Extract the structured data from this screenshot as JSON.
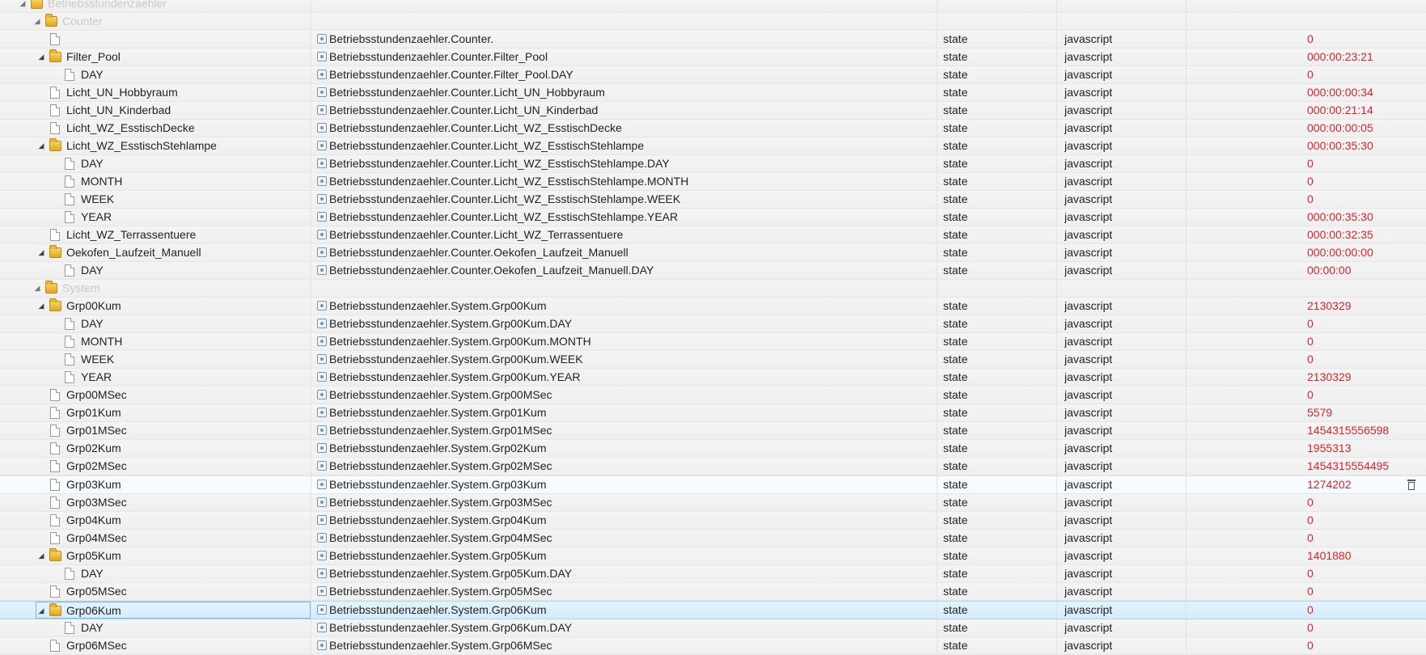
{
  "tree": {
    "rows": [
      {
        "name": "Betriebsstundenzaehler",
        "kind": "folder",
        "level": 0,
        "expanded": true,
        "group": true
      },
      {
        "name": "Counter",
        "kind": "folder",
        "level": 1,
        "expanded": true,
        "group": true
      },
      {
        "name": "",
        "kind": "file",
        "level": 2,
        "id": "Betriebsstundenzaehler.Counter.",
        "type": "state",
        "role": "javascript",
        "value": "0"
      },
      {
        "name": "Filter_Pool",
        "kind": "folder",
        "level": 2,
        "expanded": true,
        "id": "Betriebsstundenzaehler.Counter.Filter_Pool",
        "type": "state",
        "role": "javascript",
        "value": "000:00:23:21"
      },
      {
        "name": "DAY",
        "kind": "file",
        "level": 3,
        "id": "Betriebsstundenzaehler.Counter.Filter_Pool.DAY",
        "type": "state",
        "role": "javascript",
        "value": "0"
      },
      {
        "name": "Licht_UN_Hobbyraum",
        "kind": "file",
        "level": 2,
        "id": "Betriebsstundenzaehler.Counter.Licht_UN_Hobbyraum",
        "type": "state",
        "role": "javascript",
        "value": "000:00:00:34"
      },
      {
        "name": "Licht_UN_Kinderbad",
        "kind": "file",
        "level": 2,
        "id": "Betriebsstundenzaehler.Counter.Licht_UN_Kinderbad",
        "type": "state",
        "role": "javascript",
        "value": "000:00:21:14"
      },
      {
        "name": "Licht_WZ_EsstischDecke",
        "kind": "file",
        "level": 2,
        "id": "Betriebsstundenzaehler.Counter.Licht_WZ_EsstischDecke",
        "type": "state",
        "role": "javascript",
        "value": "000:00:00:05"
      },
      {
        "name": "Licht_WZ_EsstischStehlampe",
        "kind": "folder",
        "level": 2,
        "expanded": true,
        "id": "Betriebsstundenzaehler.Counter.Licht_WZ_EsstischStehlampe",
        "type": "state",
        "role": "javascript",
        "value": "000:00:35:30"
      },
      {
        "name": "DAY",
        "kind": "file",
        "level": 3,
        "id": "Betriebsstundenzaehler.Counter.Licht_WZ_EsstischStehlampe.DAY",
        "type": "state",
        "role": "javascript",
        "value": "0"
      },
      {
        "name": "MONTH",
        "kind": "file",
        "level": 3,
        "id": "Betriebsstundenzaehler.Counter.Licht_WZ_EsstischStehlampe.MONTH",
        "type": "state",
        "role": "javascript",
        "value": "0"
      },
      {
        "name": "WEEK",
        "kind": "file",
        "level": 3,
        "id": "Betriebsstundenzaehler.Counter.Licht_WZ_EsstischStehlampe.WEEK",
        "type": "state",
        "role": "javascript",
        "value": "0"
      },
      {
        "name": "YEAR",
        "kind": "file",
        "level": 3,
        "id": "Betriebsstundenzaehler.Counter.Licht_WZ_EsstischStehlampe.YEAR",
        "type": "state",
        "role": "javascript",
        "value": "000:00:35:30"
      },
      {
        "name": "Licht_WZ_Terrassentuere",
        "kind": "file",
        "level": 2,
        "id": "Betriebsstundenzaehler.Counter.Licht_WZ_Terrassentuere",
        "type": "state",
        "role": "javascript",
        "value": "000:00:32:35"
      },
      {
        "name": "Oekofen_Laufzeit_Manuell",
        "kind": "folder",
        "level": 2,
        "expanded": true,
        "id": "Betriebsstundenzaehler.Counter.Oekofen_Laufzeit_Manuell",
        "type": "state",
        "role": "javascript",
        "value": "000:00:00:00"
      },
      {
        "name": "DAY",
        "kind": "file",
        "level": 3,
        "id": "Betriebsstundenzaehler.Counter.Oekofen_Laufzeit_Manuell.DAY",
        "type": "state",
        "role": "javascript",
        "value": "00:00:00"
      },
      {
        "name": "System",
        "kind": "folder",
        "level": 1,
        "expanded": true,
        "group": true
      },
      {
        "name": "Grp00Kum",
        "kind": "folder",
        "level": 2,
        "expanded": true,
        "id": "Betriebsstundenzaehler.System.Grp00Kum",
        "type": "state",
        "role": "javascript",
        "value": "2130329"
      },
      {
        "name": "DAY",
        "kind": "file",
        "level": 3,
        "id": "Betriebsstundenzaehler.System.Grp00Kum.DAY",
        "type": "state",
        "role": "javascript",
        "value": "0"
      },
      {
        "name": "MONTH",
        "kind": "file",
        "level": 3,
        "id": "Betriebsstundenzaehler.System.Grp00Kum.MONTH",
        "type": "state",
        "role": "javascript",
        "value": "0"
      },
      {
        "name": "WEEK",
        "kind": "file",
        "level": 3,
        "id": "Betriebsstundenzaehler.System.Grp00Kum.WEEK",
        "type": "state",
        "role": "javascript",
        "value": "0"
      },
      {
        "name": "YEAR",
        "kind": "file",
        "level": 3,
        "id": "Betriebsstundenzaehler.System.Grp00Kum.YEAR",
        "type": "state",
        "role": "javascript",
        "value": "2130329"
      },
      {
        "name": "Grp00MSec",
        "kind": "file",
        "level": 2,
        "id": "Betriebsstundenzaehler.System.Grp00MSec",
        "type": "state",
        "role": "javascript",
        "value": "0"
      },
      {
        "name": "Grp01Kum",
        "kind": "file",
        "level": 2,
        "id": "Betriebsstundenzaehler.System.Grp01Kum",
        "type": "state",
        "role": "javascript",
        "value": "5579"
      },
      {
        "name": "Grp01MSec",
        "kind": "file",
        "level": 2,
        "id": "Betriebsstundenzaehler.System.Grp01MSec",
        "type": "state",
        "role": "javascript",
        "value": "1454315556598"
      },
      {
        "name": "Grp02Kum",
        "kind": "file",
        "level": 2,
        "id": "Betriebsstundenzaehler.System.Grp02Kum",
        "type": "state",
        "role": "javascript",
        "value": "1955313"
      },
      {
        "name": "Grp02MSec",
        "kind": "file",
        "level": 2,
        "id": "Betriebsstundenzaehler.System.Grp02MSec",
        "type": "state",
        "role": "javascript",
        "value": "1454315554495"
      },
      {
        "name": "Grp03Kum",
        "kind": "file",
        "level": 2,
        "id": "Betriebsstundenzaehler.System.Grp03Kum",
        "type": "state",
        "role": "javascript",
        "value": "1274202",
        "hover": true
      },
      {
        "name": "Grp03MSec",
        "kind": "file",
        "level": 2,
        "id": "Betriebsstundenzaehler.System.Grp03MSec",
        "type": "state",
        "role": "javascript",
        "value": "0"
      },
      {
        "name": "Grp04Kum",
        "kind": "file",
        "level": 2,
        "id": "Betriebsstundenzaehler.System.Grp04Kum",
        "type": "state",
        "role": "javascript",
        "value": "0"
      },
      {
        "name": "Grp04MSec",
        "kind": "file",
        "level": 2,
        "id": "Betriebsstundenzaehler.System.Grp04MSec",
        "type": "state",
        "role": "javascript",
        "value": "0"
      },
      {
        "name": "Grp05Kum",
        "kind": "folder",
        "level": 2,
        "expanded": true,
        "id": "Betriebsstundenzaehler.System.Grp05Kum",
        "type": "state",
        "role": "javascript",
        "value": "1401880"
      },
      {
        "name": "DAY",
        "kind": "file",
        "level": 3,
        "id": "Betriebsstundenzaehler.System.Grp05Kum.DAY",
        "type": "state",
        "role": "javascript",
        "value": "0"
      },
      {
        "name": "Grp05MSec",
        "kind": "file",
        "level": 2,
        "id": "Betriebsstundenzaehler.System.Grp05MSec",
        "type": "state",
        "role": "javascript",
        "value": "0"
      },
      {
        "name": "Grp06Kum",
        "kind": "folder",
        "level": 2,
        "expanded": true,
        "id": "Betriebsstundenzaehler.System.Grp06Kum",
        "type": "state",
        "role": "javascript",
        "value": "0",
        "selected": true
      },
      {
        "name": "DAY",
        "kind": "file",
        "level": 3,
        "id": "Betriebsstundenzaehler.System.Grp06Kum.DAY",
        "type": "state",
        "role": "javascript",
        "value": "0"
      },
      {
        "name": "Grp06MSec",
        "kind": "file",
        "level": 2,
        "id": "Betriebsstundenzaehler.System.Grp06MSec",
        "type": "state",
        "role": "javascript",
        "value": "0"
      }
    ]
  },
  "icons": {
    "folder": "folder-icon",
    "file": "file-icon",
    "state": "state-icon",
    "delete": "trash-icon",
    "toggle": "expand-toggle-icon"
  },
  "colors": {
    "value": "#d9262c",
    "selected_row": "#d4ecfa",
    "group_text": "#c9c9c9"
  }
}
